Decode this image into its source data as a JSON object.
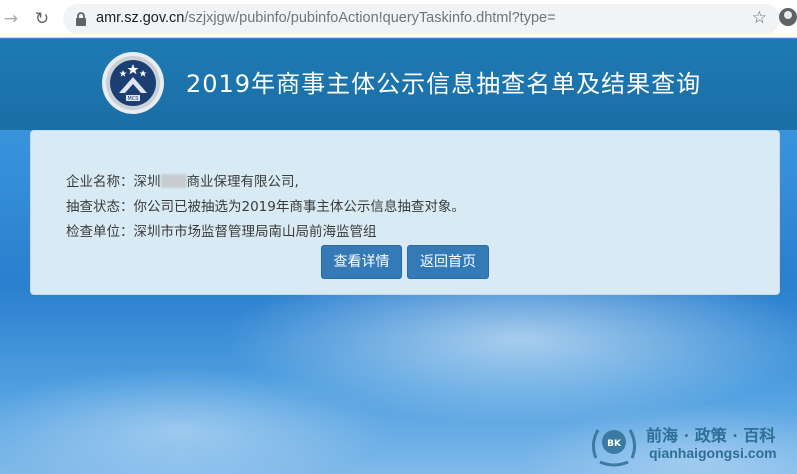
{
  "browser": {
    "url_host": "amr.sz.gov.cn",
    "url_path": "/szjxjgw/pubinfo/pubinfoAction!queryTaskinfo.dhtml?type="
  },
  "header": {
    "title": "2019年商事主体公示信息抽查名单及结果查询",
    "emblem_text": "MCS"
  },
  "result": {
    "company_label": "企业名称：",
    "company_prefix": "深圳",
    "company_suffix": "商业保理有限公司,",
    "status_label": "抽查状态：",
    "status_value": "你公司已被抽选为2019年商事主体公示信息抽查对象。",
    "unit_label": "检查单位：",
    "unit_value": "深圳市市场监督管理局南山局前海监管组",
    "details_button": "查看详情",
    "home_button": "返回首页"
  },
  "watermark": {
    "title": "前海 · 政策 · 百科",
    "domain": "qianhaigongsi.com",
    "logo_text": "BK"
  },
  "colors": {
    "header": "#1f7ab3",
    "panel": "#d8ebf5",
    "button": "#337ab7"
  }
}
